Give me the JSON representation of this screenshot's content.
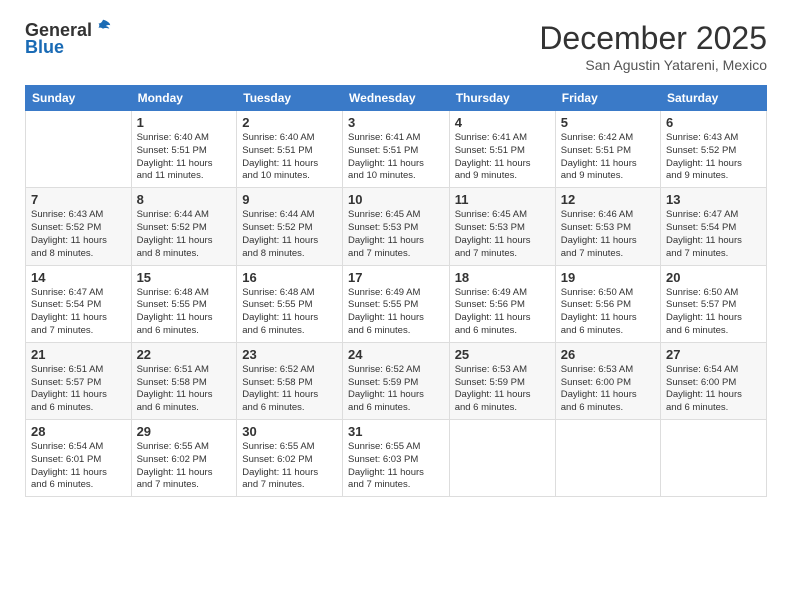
{
  "header": {
    "logo_line1": "General",
    "logo_line2": "Blue",
    "month": "December 2025",
    "location": "San Agustin Yatareni, Mexico"
  },
  "weekdays": [
    "Sunday",
    "Monday",
    "Tuesday",
    "Wednesday",
    "Thursday",
    "Friday",
    "Saturday"
  ],
  "weeks": [
    [
      {
        "day": "",
        "info": ""
      },
      {
        "day": "1",
        "info": "Sunrise: 6:40 AM\nSunset: 5:51 PM\nDaylight: 11 hours\nand 11 minutes."
      },
      {
        "day": "2",
        "info": "Sunrise: 6:40 AM\nSunset: 5:51 PM\nDaylight: 11 hours\nand 10 minutes."
      },
      {
        "day": "3",
        "info": "Sunrise: 6:41 AM\nSunset: 5:51 PM\nDaylight: 11 hours\nand 10 minutes."
      },
      {
        "day": "4",
        "info": "Sunrise: 6:41 AM\nSunset: 5:51 PM\nDaylight: 11 hours\nand 9 minutes."
      },
      {
        "day": "5",
        "info": "Sunrise: 6:42 AM\nSunset: 5:51 PM\nDaylight: 11 hours\nand 9 minutes."
      },
      {
        "day": "6",
        "info": "Sunrise: 6:43 AM\nSunset: 5:52 PM\nDaylight: 11 hours\nand 9 minutes."
      }
    ],
    [
      {
        "day": "7",
        "info": "Sunrise: 6:43 AM\nSunset: 5:52 PM\nDaylight: 11 hours\nand 8 minutes."
      },
      {
        "day": "8",
        "info": "Sunrise: 6:44 AM\nSunset: 5:52 PM\nDaylight: 11 hours\nand 8 minutes."
      },
      {
        "day": "9",
        "info": "Sunrise: 6:44 AM\nSunset: 5:52 PM\nDaylight: 11 hours\nand 8 minutes."
      },
      {
        "day": "10",
        "info": "Sunrise: 6:45 AM\nSunset: 5:53 PM\nDaylight: 11 hours\nand 7 minutes."
      },
      {
        "day": "11",
        "info": "Sunrise: 6:45 AM\nSunset: 5:53 PM\nDaylight: 11 hours\nand 7 minutes."
      },
      {
        "day": "12",
        "info": "Sunrise: 6:46 AM\nSunset: 5:53 PM\nDaylight: 11 hours\nand 7 minutes."
      },
      {
        "day": "13",
        "info": "Sunrise: 6:47 AM\nSunset: 5:54 PM\nDaylight: 11 hours\nand 7 minutes."
      }
    ],
    [
      {
        "day": "14",
        "info": "Sunrise: 6:47 AM\nSunset: 5:54 PM\nDaylight: 11 hours\nand 7 minutes."
      },
      {
        "day": "15",
        "info": "Sunrise: 6:48 AM\nSunset: 5:55 PM\nDaylight: 11 hours\nand 6 minutes."
      },
      {
        "day": "16",
        "info": "Sunrise: 6:48 AM\nSunset: 5:55 PM\nDaylight: 11 hours\nand 6 minutes."
      },
      {
        "day": "17",
        "info": "Sunrise: 6:49 AM\nSunset: 5:55 PM\nDaylight: 11 hours\nand 6 minutes."
      },
      {
        "day": "18",
        "info": "Sunrise: 6:49 AM\nSunset: 5:56 PM\nDaylight: 11 hours\nand 6 minutes."
      },
      {
        "day": "19",
        "info": "Sunrise: 6:50 AM\nSunset: 5:56 PM\nDaylight: 11 hours\nand 6 minutes."
      },
      {
        "day": "20",
        "info": "Sunrise: 6:50 AM\nSunset: 5:57 PM\nDaylight: 11 hours\nand 6 minutes."
      }
    ],
    [
      {
        "day": "21",
        "info": "Sunrise: 6:51 AM\nSunset: 5:57 PM\nDaylight: 11 hours\nand 6 minutes."
      },
      {
        "day": "22",
        "info": "Sunrise: 6:51 AM\nSunset: 5:58 PM\nDaylight: 11 hours\nand 6 minutes."
      },
      {
        "day": "23",
        "info": "Sunrise: 6:52 AM\nSunset: 5:58 PM\nDaylight: 11 hours\nand 6 minutes."
      },
      {
        "day": "24",
        "info": "Sunrise: 6:52 AM\nSunset: 5:59 PM\nDaylight: 11 hours\nand 6 minutes."
      },
      {
        "day": "25",
        "info": "Sunrise: 6:53 AM\nSunset: 5:59 PM\nDaylight: 11 hours\nand 6 minutes."
      },
      {
        "day": "26",
        "info": "Sunrise: 6:53 AM\nSunset: 6:00 PM\nDaylight: 11 hours\nand 6 minutes."
      },
      {
        "day": "27",
        "info": "Sunrise: 6:54 AM\nSunset: 6:00 PM\nDaylight: 11 hours\nand 6 minutes."
      }
    ],
    [
      {
        "day": "28",
        "info": "Sunrise: 6:54 AM\nSunset: 6:01 PM\nDaylight: 11 hours\nand 6 minutes."
      },
      {
        "day": "29",
        "info": "Sunrise: 6:55 AM\nSunset: 6:02 PM\nDaylight: 11 hours\nand 7 minutes."
      },
      {
        "day": "30",
        "info": "Sunrise: 6:55 AM\nSunset: 6:02 PM\nDaylight: 11 hours\nand 7 minutes."
      },
      {
        "day": "31",
        "info": "Sunrise: 6:55 AM\nSunset: 6:03 PM\nDaylight: 11 hours\nand 7 minutes."
      },
      {
        "day": "",
        "info": ""
      },
      {
        "day": "",
        "info": ""
      },
      {
        "day": "",
        "info": ""
      }
    ]
  ]
}
